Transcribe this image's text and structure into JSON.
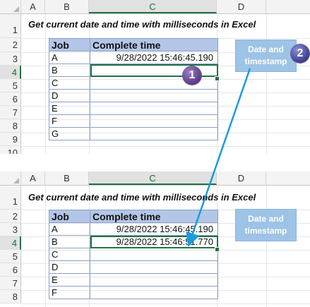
{
  "columns": [
    "A",
    "B",
    "C",
    "D"
  ],
  "top": {
    "rows": [
      "1",
      "2",
      "3",
      "4",
      "5",
      "6",
      "7",
      "8",
      "9",
      "10"
    ],
    "title": "Get current date and time with milliseconds in Excel",
    "table": {
      "headers": [
        "Job",
        "Complete time"
      ],
      "rows": [
        [
          "A",
          "9/28/2022 15:46:45.190"
        ],
        [
          "B",
          ""
        ],
        [
          "C",
          ""
        ],
        [
          "D",
          ""
        ],
        [
          "E",
          ""
        ],
        [
          "F",
          ""
        ],
        [
          "G",
          ""
        ]
      ]
    },
    "button_label": "Date and timestamp",
    "badge1": "1",
    "badge2": "2"
  },
  "bottom": {
    "rows": [
      "1",
      "2",
      "3",
      "4",
      "5",
      "6",
      "7",
      "8"
    ],
    "title": "Get current date and time with milliseconds in Excel",
    "table": {
      "headers": [
        "Job",
        "Complete time"
      ],
      "rows": [
        [
          "A",
          "9/28/2022 15:46:45.190"
        ],
        [
          "B",
          "9/28/2022 15:46:51.770"
        ],
        [
          "C",
          ""
        ],
        [
          "D",
          ""
        ],
        [
          "E",
          ""
        ],
        [
          "F",
          ""
        ]
      ]
    },
    "button_label": "Date and timestamp"
  },
  "colors": {
    "header_fill": "#b4c6e7",
    "button_fill": "#9dc3e6",
    "selection": "#217346",
    "badge": "#6a4a98",
    "arrow": "#1a9be0"
  }
}
